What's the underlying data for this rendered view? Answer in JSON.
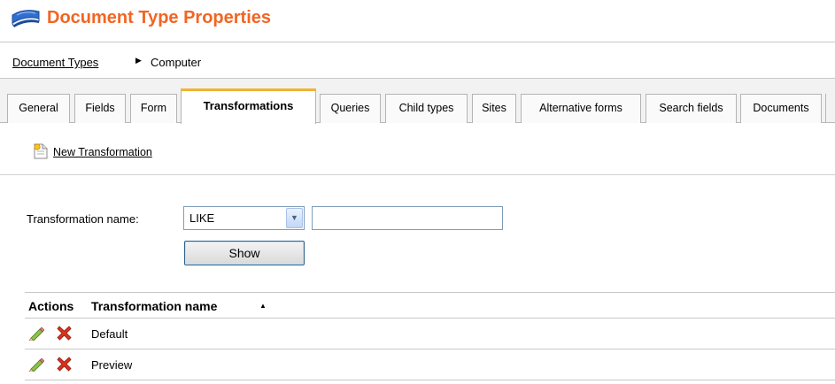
{
  "header": {
    "title": "Document Type Properties",
    "icon": "book-icon",
    "title_color": "#f26522"
  },
  "breadcrumb": {
    "link_label": "Document Types",
    "separator_icon": "triangle-right-icon",
    "current": "Computer"
  },
  "tabs": [
    {
      "label": "General",
      "active": false
    },
    {
      "label": "Fields",
      "active": false
    },
    {
      "label": "Form",
      "active": false
    },
    {
      "label": "Transformations",
      "active": true
    },
    {
      "label": "Queries",
      "active": false
    },
    {
      "label": "Child types",
      "active": false
    },
    {
      "label": "Sites",
      "active": false
    },
    {
      "label": "Alternative forms",
      "active": false
    },
    {
      "label": "Search fields",
      "active": false
    },
    {
      "label": "Documents",
      "active": false
    }
  ],
  "actions": {
    "new_label": "New Transformation",
    "new_icon": "new-document-icon"
  },
  "filter": {
    "label": "Transformation name:",
    "operator": "LIKE",
    "value": "",
    "show_label": "Show"
  },
  "grid": {
    "columns": [
      "Actions",
      "Transformation name"
    ],
    "sort_icon": "sort-ascending-icon",
    "rows": [
      {
        "name": "Default"
      },
      {
        "name": "Preview"
      }
    ]
  },
  "colors": {
    "accent": "#f26522",
    "active_tab_top": "#f2b233"
  }
}
